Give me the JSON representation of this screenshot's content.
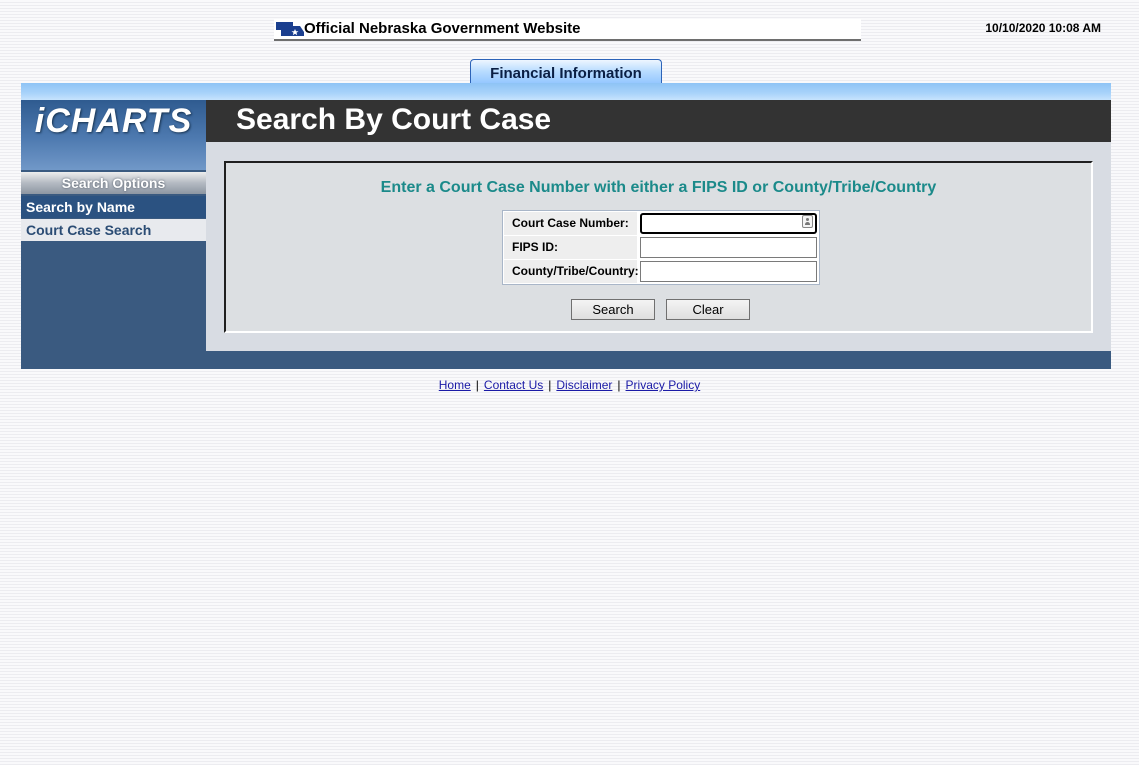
{
  "header": {
    "site_title": "Official Nebraska Government Website",
    "datetime": "10/10/2020 10:08 AM",
    "tab_label": "Financial Information"
  },
  "sidebar": {
    "logo": "iCHARTS",
    "options_header": "Search Options",
    "items": [
      {
        "label": "Search by Name",
        "active": false
      },
      {
        "label": "Court Case Search",
        "active": true
      }
    ]
  },
  "main": {
    "title": "Search By Court Case",
    "instruction": "Enter a Court Case Number with either a FIPS ID or County/Tribe/Country",
    "fields": [
      {
        "label": "Court Case Number:",
        "value": ""
      },
      {
        "label": "FIPS ID:",
        "value": ""
      },
      {
        "label": "County/Tribe/Country:",
        "value": ""
      }
    ],
    "search_button": "Search",
    "clear_button": "Clear"
  },
  "footer": {
    "links": [
      "Home",
      "Contact Us",
      "Disclaimer",
      "Privacy Policy"
    ],
    "separator": "|"
  },
  "colors": {
    "title_bar": "#333333",
    "sidebar_bg": "#3a5a80",
    "instruction_text": "#1b8a8a",
    "link": "#1a1aa6"
  },
  "icons": {
    "state_logo": "nebraska-map-icon",
    "input_autofill": "contact-card-icon"
  }
}
